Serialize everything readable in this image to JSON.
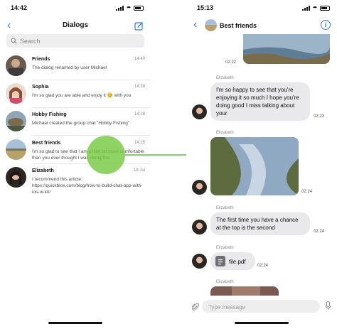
{
  "left": {
    "status_time": "14:42",
    "title": "Dialogs",
    "search_placeholder": "Search",
    "dialogs": [
      {
        "name": "Friends",
        "time": "14:40",
        "message": "The dialog renamed by user Michael"
      },
      {
        "name": "Sophia",
        "time": "14:39",
        "message": "I'm so glad you are able and enjoy it 😊 with you"
      },
      {
        "name": "Hobby Fishing",
        "time": "14:28",
        "message": "Michael created the group chat \"Hobby Fishing\""
      },
      {
        "name": "Best friends",
        "time": "14:25",
        "message": "I'm so glad to see that I am a little bit more comfortable than you ever thought I was doing this"
      },
      {
        "name": "Elizabeth",
        "time": "18 Jul",
        "message": "I recommend this article: https://quickblox.com/blog/how-to-build-chat-app-with-ios-ui-kit/"
      }
    ]
  },
  "right": {
    "status_time": "15:13",
    "title": "Best friends",
    "messages": [
      {
        "kind": "image",
        "sender": "",
        "time": "02:22"
      },
      {
        "kind": "text",
        "sender": "Elizabeth",
        "text": "I'm so happy to see that you're enjoying it so much I hope you're doing good I miss talking about your",
        "time": "02:23"
      },
      {
        "kind": "image",
        "sender": "Elizabeth",
        "time": "02:24"
      },
      {
        "kind": "text",
        "sender": "Elizabeth",
        "text": "The first time you have a chance at the top is the second",
        "time": "02:24"
      },
      {
        "kind": "file",
        "sender": "Elizabeth",
        "file_name": "file.pdf",
        "time": "02:24"
      },
      {
        "kind": "image",
        "sender": "Elizabeth",
        "time": ""
      }
    ],
    "input_placeholder": "Type message"
  },
  "colors": {
    "accent": "#3478f6",
    "bubble": "#e9e9eb",
    "gesture": "#76c943",
    "arrow": "#5cc23a"
  },
  "icons": {
    "back": "chevron-left-icon",
    "compose": "compose-icon",
    "search": "search-icon",
    "info": "info-icon",
    "attach": "paperclip-icon",
    "mic": "microphone-icon",
    "file": "document-icon"
  }
}
